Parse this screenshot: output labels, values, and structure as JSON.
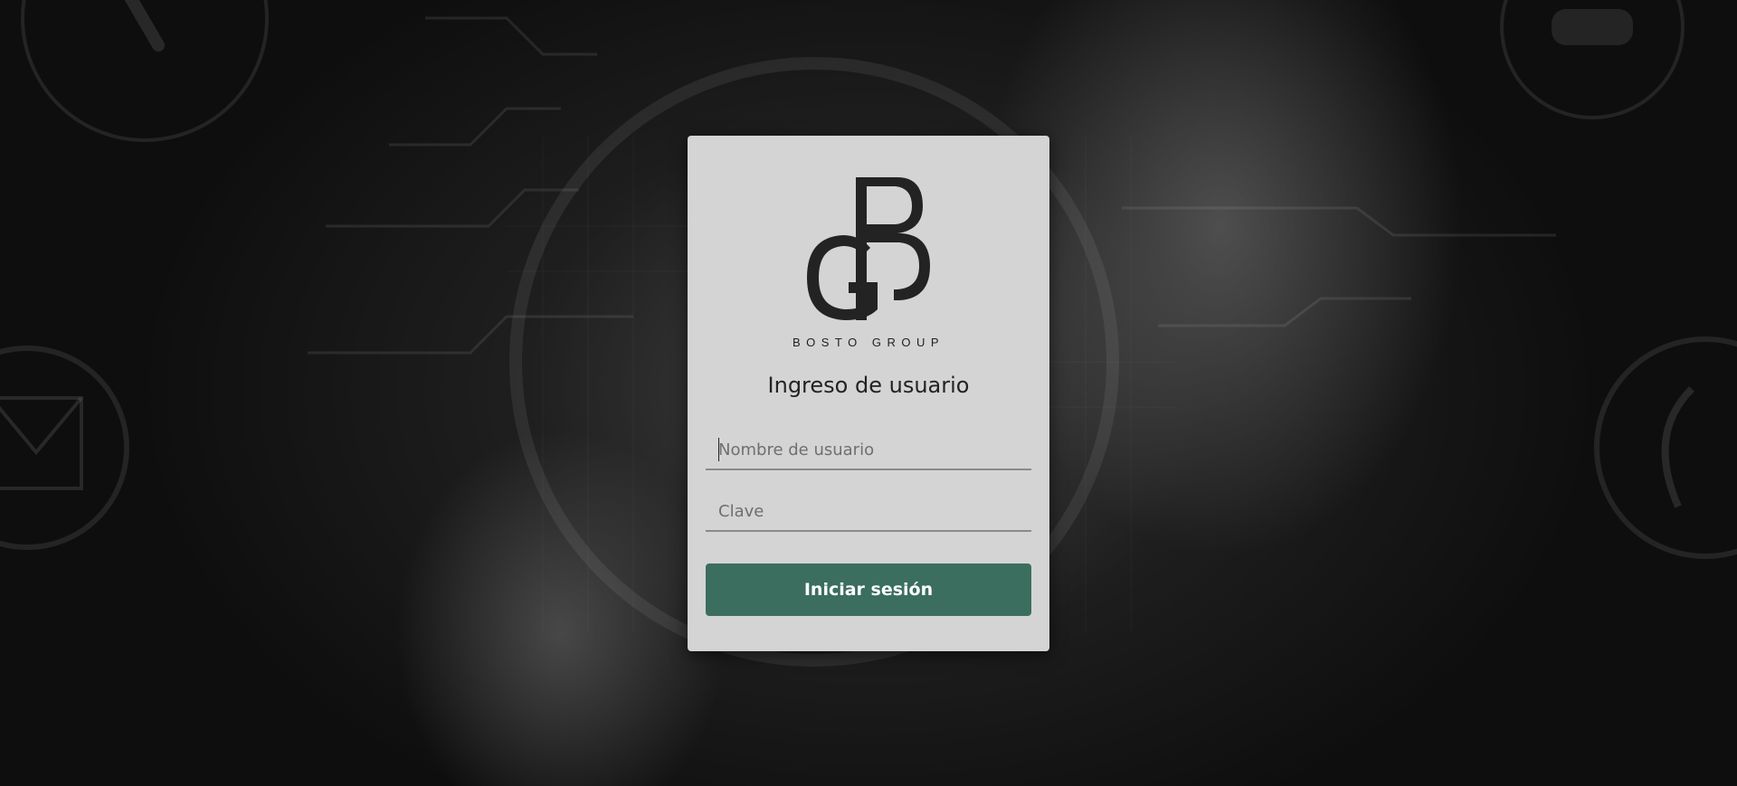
{
  "brand": {
    "logo_letters": "BG",
    "name": "BOSTO GROUP"
  },
  "login": {
    "title": "Ingreso de usuario",
    "username_placeholder": "Nombre de usuario",
    "username_value": "",
    "password_placeholder": "Clave",
    "password_value": "",
    "submit_label": "Iniciar sesión"
  },
  "colors": {
    "card_background": "#d4d4d4",
    "button_background": "#3b6e5e",
    "button_text": "#ffffff"
  },
  "icons": [
    "phone-icon",
    "mail-icon",
    "headset-icon",
    "user-icon"
  ]
}
